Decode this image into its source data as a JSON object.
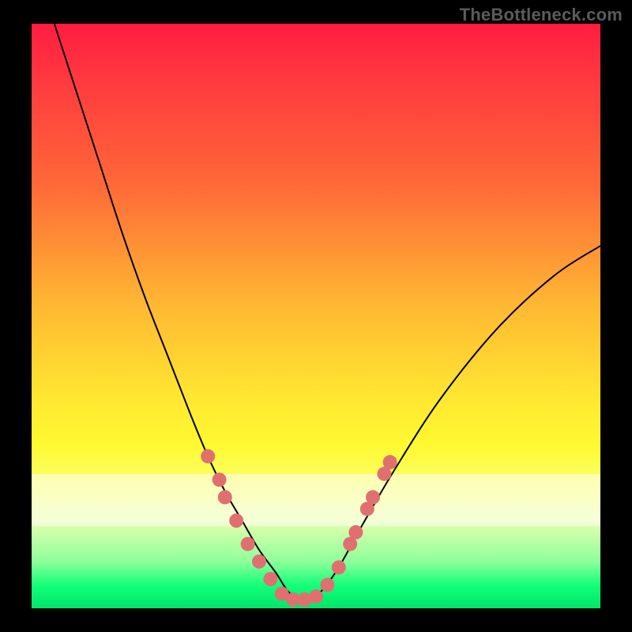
{
  "watermark": "TheBottleneck.com",
  "colors": {
    "dot": "#e07070",
    "curve": "#000000",
    "frame": "#000000"
  },
  "chart_data": {
    "type": "line",
    "title": "",
    "xlabel": "",
    "ylabel": "",
    "xlim": [
      0,
      100
    ],
    "ylim": [
      0,
      100
    ],
    "background_gradient": [
      "#ff1d40",
      "#ffe731",
      "#00e56a"
    ],
    "series": [
      {
        "name": "bottleneck-curve",
        "x": [
          4,
          8,
          12,
          16,
          20,
          24,
          28,
          31,
          34,
          37,
          40,
          43,
          45,
          47,
          49,
          51,
          54,
          58,
          64,
          72,
          82,
          92,
          100
        ],
        "y": [
          100,
          88,
          76,
          64,
          53,
          43,
          33,
          26,
          20,
          15,
          10,
          6,
          3,
          1.5,
          1.5,
          3,
          7,
          14,
          24,
          36,
          48,
          57,
          62
        ]
      }
    ],
    "dots": {
      "name": "bottleneck-dots",
      "points": [
        {
          "x": 31,
          "y": 26
        },
        {
          "x": 33,
          "y": 22
        },
        {
          "x": 34,
          "y": 19
        },
        {
          "x": 36,
          "y": 15
        },
        {
          "x": 38,
          "y": 11
        },
        {
          "x": 40,
          "y": 8
        },
        {
          "x": 42,
          "y": 5
        },
        {
          "x": 44,
          "y": 2.5
        },
        {
          "x": 46,
          "y": 1.5
        },
        {
          "x": 48,
          "y": 1.5
        },
        {
          "x": 50,
          "y": 2
        },
        {
          "x": 52,
          "y": 4
        },
        {
          "x": 54,
          "y": 7
        },
        {
          "x": 56,
          "y": 11
        },
        {
          "x": 57,
          "y": 13
        },
        {
          "x": 59,
          "y": 17
        },
        {
          "x": 60,
          "y": 19
        },
        {
          "x": 62,
          "y": 23
        },
        {
          "x": 63,
          "y": 25
        }
      ]
    },
    "pale_band_y": [
      14,
      23
    ]
  }
}
